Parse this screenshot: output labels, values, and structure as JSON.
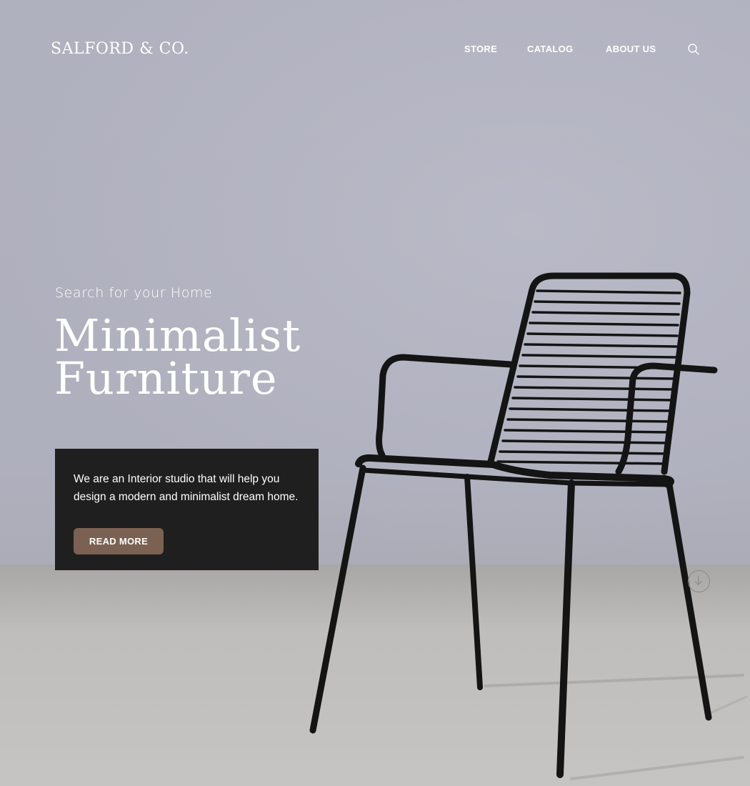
{
  "brand": {
    "name": "SALFORD & CO."
  },
  "nav": {
    "items": [
      {
        "label": "STORE"
      },
      {
        "label": "CATALOG"
      },
      {
        "label": "ABOUT US"
      }
    ],
    "search_icon": "search-icon"
  },
  "hero": {
    "kicker": "Search for your Home",
    "headline_line1": "Minimalist",
    "headline_line2": "Furniture",
    "description": "We are an Interior studio that will help you design a modern and minimalist dream home.",
    "cta_label": "READ MORE",
    "scroll_icon": "arrow-down-circle-icon"
  },
  "colors": {
    "wall": "#b5b6c3",
    "floor": "#c5c3c1",
    "card": "#1f1f1f",
    "cta": "#7a6152",
    "text": "#ffffff"
  }
}
